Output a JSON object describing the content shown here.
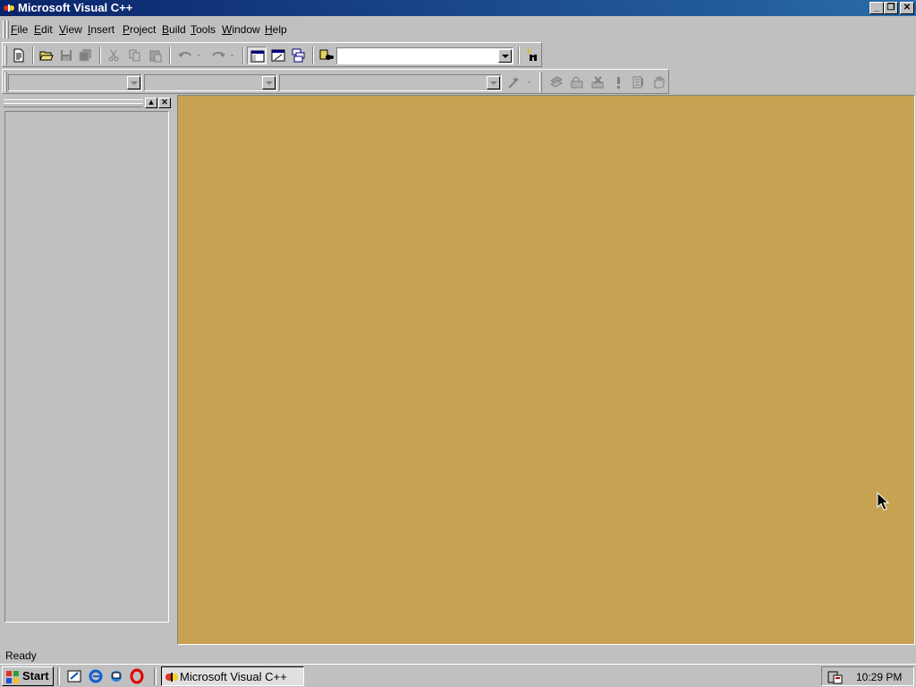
{
  "window": {
    "title": "Microsoft Visual C++"
  },
  "menu": {
    "items": [
      {
        "label": "File",
        "accel": "F"
      },
      {
        "label": "Edit",
        "accel": "E"
      },
      {
        "label": "View",
        "accel": "V"
      },
      {
        "label": "Insert",
        "accel": "I"
      },
      {
        "label": "Project",
        "accel": "P"
      },
      {
        "label": "Build",
        "accel": "B"
      },
      {
        "label": "Tools",
        "accel": "T"
      },
      {
        "label": "Window",
        "accel": "W"
      },
      {
        "label": "Help",
        "accel": "H"
      }
    ]
  },
  "toolbar": {
    "find_combo_value": "",
    "class_combo_value": "",
    "filter_combo_value": "",
    "members_combo_value": ""
  },
  "status": {
    "text": "Ready"
  },
  "taskbar": {
    "start_label": "Start",
    "task_label": "Microsoft Visual C++",
    "clock": "10:29 PM"
  },
  "colors": {
    "titlebar": "#0a246a",
    "mdi_background": "#c8a253",
    "face": "#c0c0c0"
  }
}
